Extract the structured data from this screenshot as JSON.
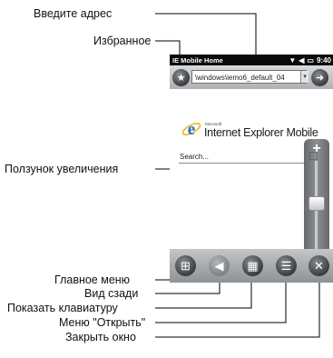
{
  "callouts": {
    "address": "Введите адрес",
    "favorites": "Избранное",
    "zoom_slider": "Ползунок увеличения",
    "main_menu": "Главное меню",
    "back": "Вид сзади",
    "keyboard": "Показать клавиатуру",
    "open_menu": "Меню \"Открыть\"",
    "close_window": "Закрыть окно"
  },
  "device": {
    "status_bar": {
      "title": "IE Mobile Home",
      "time": "9:40"
    },
    "address_bar": {
      "url": "\\windows\\iemo6_default_04"
    },
    "page": {
      "brand_small": "Microsoft",
      "product_name": "Internet Explorer Mobile",
      "search_label": "Search..."
    },
    "zoom": {
      "plus": "+",
      "minus": "−",
      "level_percent": 45
    }
  },
  "colors": {
    "status_bar": "#0a0a0a",
    "ie_blue": "#1e6fd0",
    "ie_ring": "#f2b51c",
    "button_dark": "#3a3c3f"
  },
  "icons": [
    "favorites-star-icon",
    "go-arrow-icon",
    "windows-flag-icon",
    "back-arrow-icon",
    "keyboard-icon",
    "menu-list-icon",
    "close-x-icon",
    "signal-icon",
    "volume-icon",
    "battery-icon"
  ]
}
